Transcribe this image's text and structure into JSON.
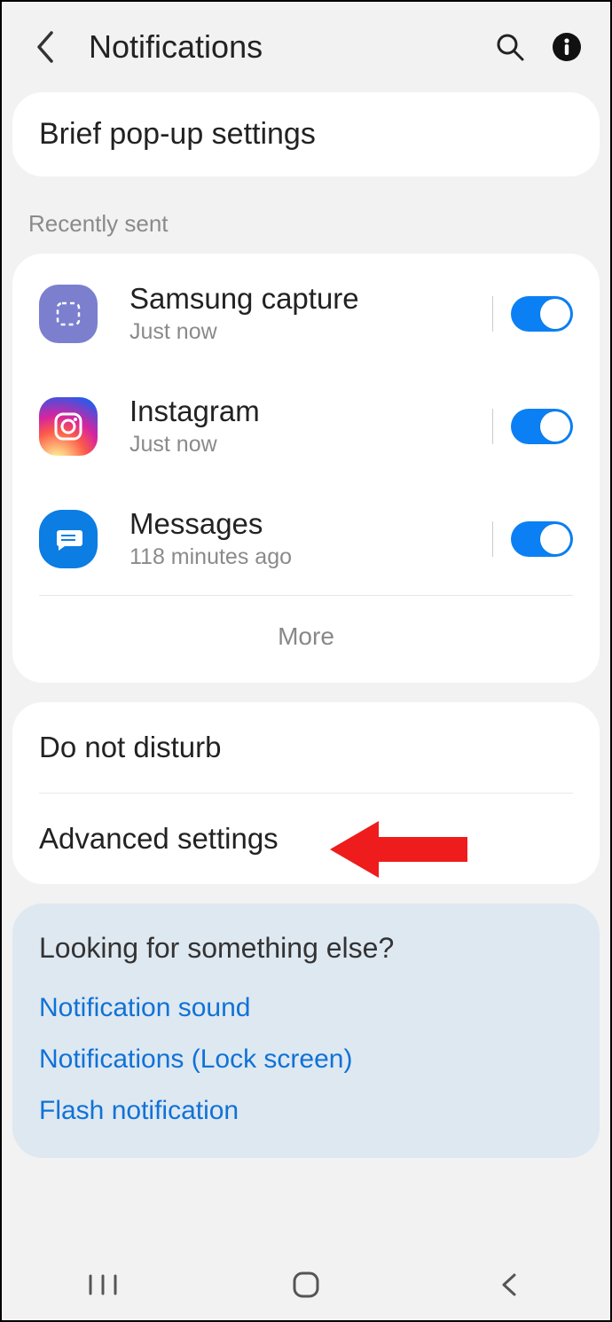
{
  "header": {
    "title": "Notifications"
  },
  "brief_popup": "Brief pop-up settings",
  "recent_label": "Recently sent",
  "apps": [
    {
      "name": "Samsung capture",
      "sub": "Just now",
      "on": true
    },
    {
      "name": "Instagram",
      "sub": "Just now",
      "on": true
    },
    {
      "name": "Messages",
      "sub": "118 minutes ago",
      "on": true
    }
  ],
  "more": "More",
  "menu": {
    "dnd": "Do not disturb",
    "advanced": "Advanced settings"
  },
  "looking": {
    "title": "Looking for something else?",
    "links": [
      "Notification sound",
      "Notifications (Lock screen)",
      "Flash notification"
    ]
  }
}
